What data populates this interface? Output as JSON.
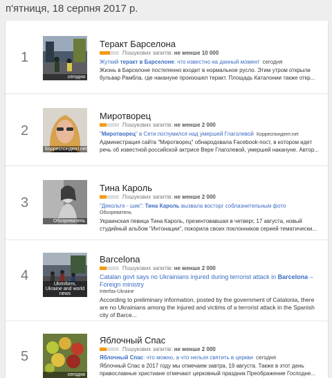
{
  "date_header": "п'ятниця, 18 серпня 2017 р.",
  "colors": {
    "accent_link": "#3b6cc1",
    "volume_bar": "#f39c12"
  },
  "trends": [
    {
      "rank": "1",
      "title": "Теракт Барселона",
      "thumb_source": "сегодня",
      "thumb_icon": "street-scene-image",
      "volume_label": "Пошукових запитів:",
      "volume_value": "не менше 10 000",
      "volume_fill": 0.55,
      "headline_pre": "Жуткий ",
      "headline_hl": "теракт в Барселоне",
      "headline_post": ": что известно на данный момент",
      "headline_age": "сегодня",
      "publisher": "",
      "snippet": "Жизнь в Барселоне постепенно входит в нормальное русло. Этим утром открыли бульвар Рамбла, где накануне произошел теракт. Площадь Каталонии также откр..."
    },
    {
      "rank": "2",
      "title": "Миротворец",
      "thumb_source": "Корреспондент.net",
      "thumb_icon": "woman-portrait-image",
      "volume_label": "Пошукових запитів:",
      "volume_value": "не менше 2 000",
      "volume_fill": 0.35,
      "headline_pre": "\"",
      "headline_hl": "Миротворец",
      "headline_post": "\" в Сети поглумился над умершей Глаголевой",
      "headline_age": "",
      "publisher": "Корреспондент.net",
      "snippet": "Администрация сайта \"Миротворец\" обнародовала Facebook-пост, в котором идет речь об известной российской актрисе Вере Глаголевой, умершей накануне. Автор..."
    },
    {
      "rank": "3",
      "title": "Тина Кароль",
      "thumb_source": "Обозреватель",
      "thumb_icon": "singer-portrait-image",
      "volume_label": "Пошукових запитів:",
      "volume_value": "не менше 2 000",
      "volume_fill": 0.35,
      "headline_pre": "\"Декольте - шик\": ",
      "headline_hl": "Тина Кароль",
      "headline_post": " вызвала восторг соблазнительным фото",
      "headline_age": "",
      "publisher": "Обозреватель",
      "snippet": "Украинская певица Тина Кароль, презентовавшая в четверг, 17 августа, новый студийный альбом \"Интонации\", покорила своих поклонников серией тематически..."
    },
    {
      "rank": "4",
      "title": "Barcelona",
      "thumb_source": "Ukrinform, Ukraine and world news",
      "thumb_icon": "street-scene-image",
      "volume_label": "Пошукових запитів:",
      "volume_value": "не менше 2 000",
      "volume_fill": 0.35,
      "headline_pre": "Catalan govt says no Ukrainians injured during terrorist attack in ",
      "headline_hl": "Barcelona",
      "headline_post": " – Foreign ministry",
      "headline_age": "",
      "publisher": "Interfax-Ukraine",
      "snippet": "According to preliminary information, posted by the government of Catalonia, there are no Ukrainians among the injured and victims of a terrorist attack in the Spanish city of Barce..."
    },
    {
      "rank": "5",
      "title": "Яблочный Спас",
      "thumb_source": "сегодня",
      "thumb_icon": "fruit-basket-image",
      "volume_label": "Пошукових запитів:",
      "volume_value": "не менше 2 000",
      "volume_fill": 0.35,
      "headline_pre": "",
      "headline_hl": "Яблочный Спас",
      "headline_post": ": что можно, а что нельзя святить в церкви",
      "headline_age": "сегодня",
      "publisher": "",
      "snippet": "Яблочный Спас в 2017 году мы отмечаем завтра, 19 августа. Также в этот день православные христиане отмечают церковный праздник Преображение Господне..."
    }
  ]
}
